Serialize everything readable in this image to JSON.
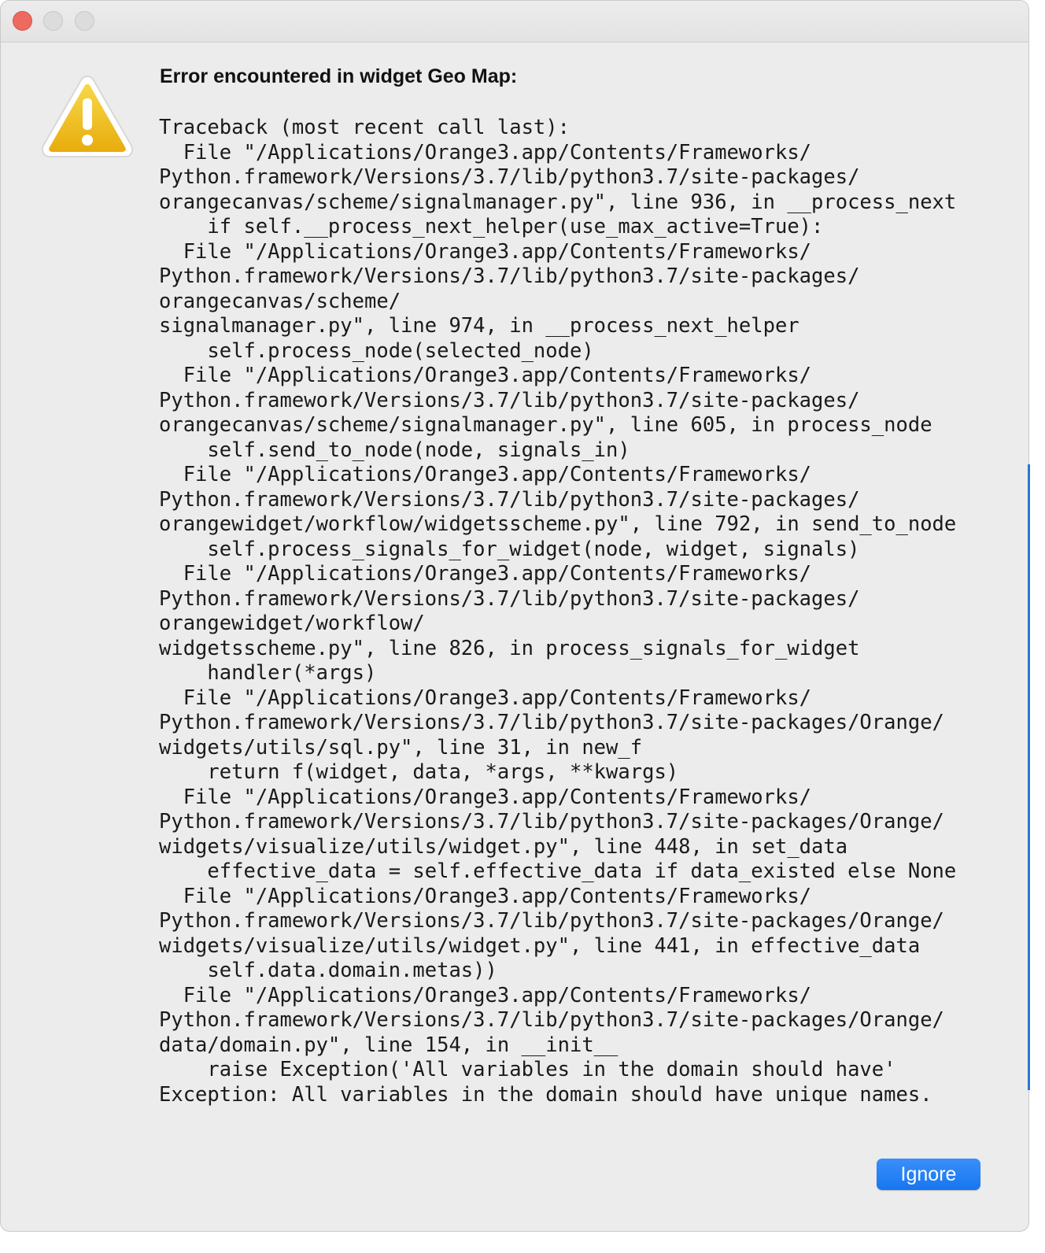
{
  "dialog": {
    "heading": "Error encountered in widget Geo Map:",
    "traceback_lines": [
      "Traceback (most recent call last):",
      "  File \"/Applications/Orange3.app/Contents/Frameworks/",
      "Python.framework/Versions/3.7/lib/python3.7/site-packages/",
      "orangecanvas/scheme/signalmanager.py\", line 936, in __process_next",
      "    if self.__process_next_helper(use_max_active=True):",
      "  File \"/Applications/Orange3.app/Contents/Frameworks/",
      "Python.framework/Versions/3.7/lib/python3.7/site-packages/",
      "orangecanvas/scheme/",
      "signalmanager.py\", line 974, in __process_next_helper",
      "    self.process_node(selected_node)",
      "  File \"/Applications/Orange3.app/Contents/Frameworks/",
      "Python.framework/Versions/3.7/lib/python3.7/site-packages/",
      "orangecanvas/scheme/signalmanager.py\", line 605, in process_node",
      "    self.send_to_node(node, signals_in)",
      "  File \"/Applications/Orange3.app/Contents/Frameworks/",
      "Python.framework/Versions/3.7/lib/python3.7/site-packages/",
      "orangewidget/workflow/widgetsscheme.py\", line 792, in send_to_node",
      "    self.process_signals_for_widget(node, widget, signals)",
      "  File \"/Applications/Orange3.app/Contents/Frameworks/",
      "Python.framework/Versions/3.7/lib/python3.7/site-packages/",
      "orangewidget/workflow/",
      "widgetsscheme.py\", line 826, in process_signals_for_widget",
      "    handler(*args)",
      "  File \"/Applications/Orange3.app/Contents/Frameworks/",
      "Python.framework/Versions/3.7/lib/python3.7/site-packages/Orange/",
      "widgets/utils/sql.py\", line 31, in new_f",
      "    return f(widget, data, *args, **kwargs)",
      "  File \"/Applications/Orange3.app/Contents/Frameworks/",
      "Python.framework/Versions/3.7/lib/python3.7/site-packages/Orange/",
      "widgets/visualize/utils/widget.py\", line 448, in set_data",
      "    effective_data = self.effective_data if data_existed else None",
      "  File \"/Applications/Orange3.app/Contents/Frameworks/",
      "Python.framework/Versions/3.7/lib/python3.7/site-packages/Orange/",
      "widgets/visualize/utils/widget.py\", line 441, in effective_data",
      "    self.data.domain.metas))",
      "  File \"/Applications/Orange3.app/Contents/Frameworks/",
      "Python.framework/Versions/3.7/lib/python3.7/site-packages/Orange/",
      "data/domain.py\", line 154, in __init__",
      "    raise Exception('All variables in the domain should have'",
      "Exception: All variables in the domain should have unique names."
    ],
    "ignore_label": "Ignore"
  },
  "icons": {
    "warning": "warning-icon",
    "close": "close-window-icon",
    "minimize": "minimize-window-icon",
    "zoom": "zoom-window-icon"
  },
  "colors": {
    "close_button": "#ee6a5e",
    "inactive_button": "#dcdcdc",
    "warning_fill": "#f2c12e",
    "primary_button": "#1676f0"
  }
}
